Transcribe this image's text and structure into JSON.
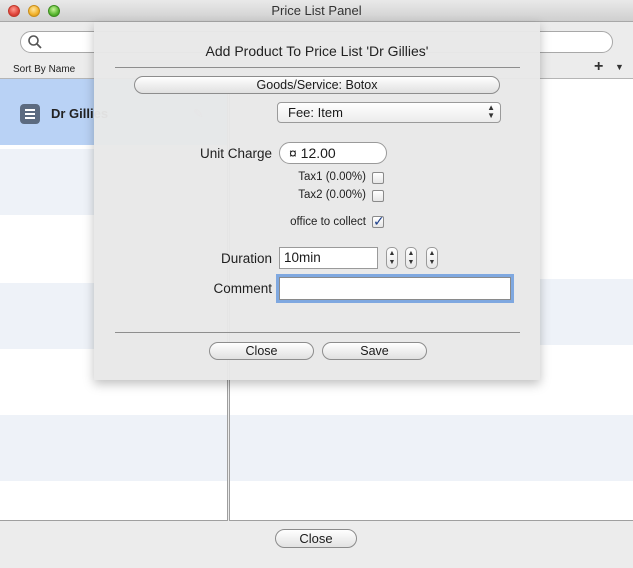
{
  "window": {
    "title": "Price List Panel"
  },
  "main": {
    "search_placeholder": "",
    "sort_label": "Sort By Name",
    "doctor_name": "Dr Gillies",
    "add_symbol": "+",
    "menu_symbol": "▼",
    "close_label": "Close"
  },
  "dialog": {
    "title": "Add Product To Price List 'Dr Gillies'",
    "goods_label": "Goods/Service: Botox",
    "fee_value": "Fee: Item",
    "unit_charge_label": "Unit Charge",
    "unit_charge_value": "¤ 12.00",
    "tax1_label": "Tax1 (0.00%)",
    "tax1_checked": false,
    "tax2_label": "Tax2 (0.00%)",
    "tax2_checked": false,
    "office_collect_label": "office to collect",
    "office_collect_checked": true,
    "duration_label": "Duration",
    "duration_value": "10min",
    "comment_label": "Comment",
    "comment_value": "",
    "close_label": "Close",
    "save_label": "Save"
  }
}
